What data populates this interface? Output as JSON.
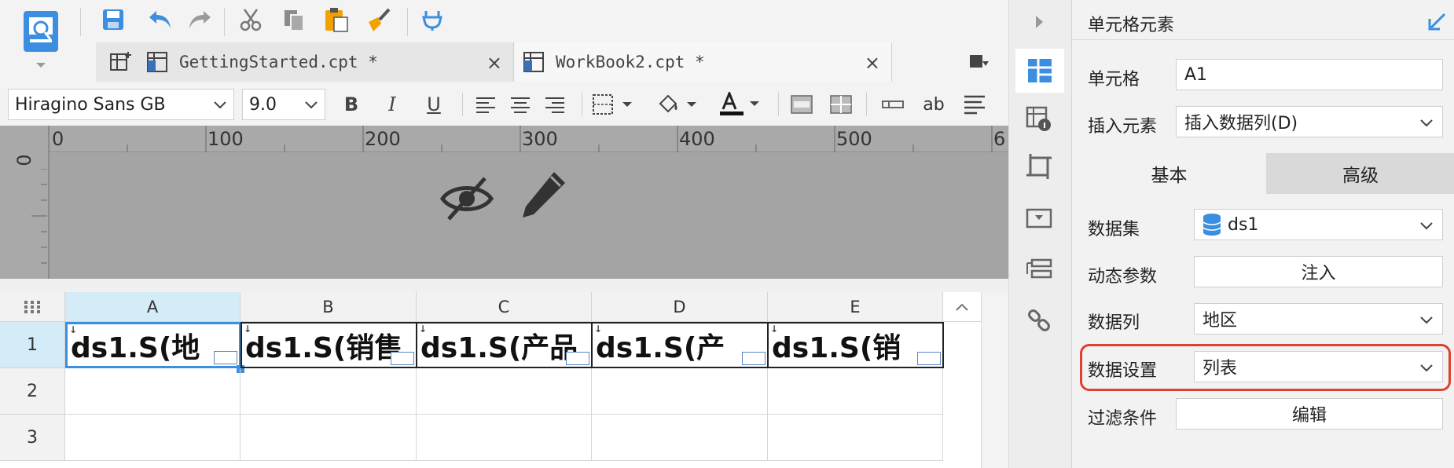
{
  "toolbar": {
    "icons": [
      "new-template-icon",
      "save-icon",
      "undo-icon",
      "redo-icon",
      "cut-icon",
      "copy-icon",
      "paste-icon",
      "format-painter-icon",
      "plug-icon"
    ]
  },
  "tabs": [
    {
      "label": "GettingStarted.cpt *",
      "close": "×"
    },
    {
      "label": "WorkBook2.cpt *",
      "close": "×"
    }
  ],
  "format_bar": {
    "font_family": "Hiragino Sans GB",
    "font_size": "9.0",
    "bold": "B",
    "italic": "I",
    "underline": "U",
    "text_direction": "ab"
  },
  "ruler": {
    "ticks": [
      "0",
      "100",
      "200",
      "300",
      "400",
      "500",
      "6"
    ],
    "vertical_tick": "0"
  },
  "sheet": {
    "columns": [
      "A",
      "B",
      "C",
      "D",
      "E"
    ],
    "rows": [
      "1",
      "2",
      "3"
    ],
    "row1_cells": [
      "ds1.S(地",
      "ds1.S(销售",
      "ds1.S(产品",
      "ds1.S(产",
      "ds1.S(销"
    ],
    "selected_cell": "A1"
  },
  "panel": {
    "title": "单元格元素",
    "cell_label": "单元格",
    "cell_value": "A1",
    "insert_label": "插入元素",
    "insert_value": "插入数据列(D)",
    "tab_basic": "基本",
    "tab_advanced": "高级",
    "dataset_label": "数据集",
    "dataset_value": "ds1",
    "dynamic_param_label": "动态参数",
    "inject_button": "注入",
    "column_label": "数据列",
    "column_value": "地区",
    "data_setting_label": "数据设置",
    "data_setting_value": "列表",
    "filter_label": "过滤条件",
    "edit_button": "编辑"
  },
  "colors": {
    "accent": "#3b8ee0",
    "highlight": "#e0402c",
    "selected_header": "#d3ecf8"
  }
}
